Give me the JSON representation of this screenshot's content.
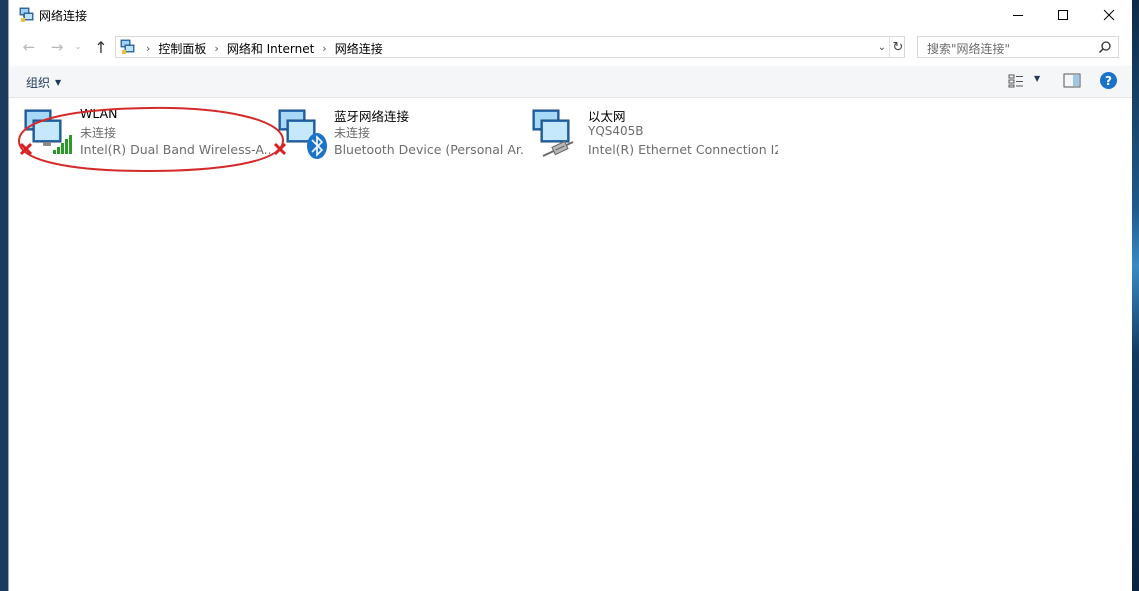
{
  "window": {
    "title": "网络连接",
    "controls": {
      "minimize": "—",
      "maximize": "☐",
      "close": "✕"
    }
  },
  "nav": {
    "back": "←",
    "forward": "→",
    "recent": "⌄",
    "up": "↑"
  },
  "address": {
    "crumbs": [
      "控制面板",
      "网络和 Internet",
      "网络连接"
    ],
    "separator": "›",
    "dropdown": "⌄",
    "refresh": "↻"
  },
  "search": {
    "placeholder": "搜索\"网络连接\""
  },
  "commandbar": {
    "organize_label": "组织",
    "help": "?"
  },
  "connections": [
    {
      "name": "WLAN",
      "status": "未连接",
      "device": "Intel(R) Dual Band Wireless-A...",
      "badge": "wifi",
      "disconnected": true
    },
    {
      "name": "蓝牙网络连接",
      "status": "未连接",
      "device": "Bluetooth Device (Personal Ar...",
      "badge": "bluetooth",
      "disconnected": true
    },
    {
      "name": "以太网",
      "status": "YQS405B",
      "device": "Intel(R) Ethernet Connection I2...",
      "badge": "ethernet",
      "disconnected": false
    }
  ],
  "colors": {
    "accent": "#1a73c9",
    "annotation": "#d42a2a",
    "error_x": "#d81e1e",
    "wifi_bars": "#2a9a2a"
  }
}
